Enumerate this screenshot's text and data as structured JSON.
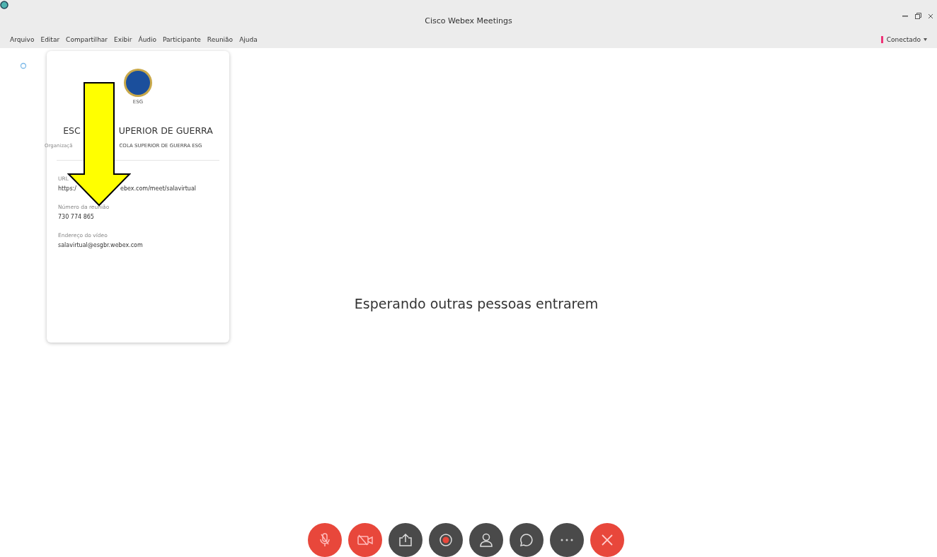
{
  "window": {
    "title": "Cisco Webex Meetings"
  },
  "menu": [
    "Arquivo",
    "Editar",
    "Compartilhar",
    "Exibir",
    "Áudio",
    "Participante",
    "Reunião",
    "Ajuda"
  ],
  "connection": {
    "label": "Conectado"
  },
  "info_card": {
    "logo_caption": "ESG",
    "title": [
      "ESC",
      "UPERIOR DE GUERRA"
    ],
    "organization": [
      "Organizaçã",
      "COLA SUPERIOR DE GUERRA ESG"
    ],
    "fields": [
      {
        "label": [
          "URL"
        ],
        "value": [
          "https:/",
          "ebex.com/meet/salavirtual"
        ]
      },
      {
        "label": [
          "Número da reunião"
        ],
        "value": [
          "730 774 865"
        ]
      },
      {
        "label": [
          "Endereço do vídeo"
        ],
        "value": [
          "salavirtual@esgbr.webex.com"
        ]
      }
    ]
  },
  "status": "Esperando outras pessoas entrarem",
  "controls": [
    {
      "kind": "mic",
      "color": "#e8473b"
    },
    {
      "kind": "video",
      "color": "#e8473b"
    },
    {
      "kind": "share",
      "color": "#4a4a4a"
    },
    {
      "kind": "record",
      "color": "#4a4a4a"
    },
    {
      "kind": "participants",
      "color": "#4a4a4a"
    },
    {
      "kind": "chat",
      "color": "#4a4a4a"
    },
    {
      "kind": "more",
      "color": "#4a4a4a"
    },
    {
      "kind": "leave",
      "color": "#e8473b"
    }
  ]
}
